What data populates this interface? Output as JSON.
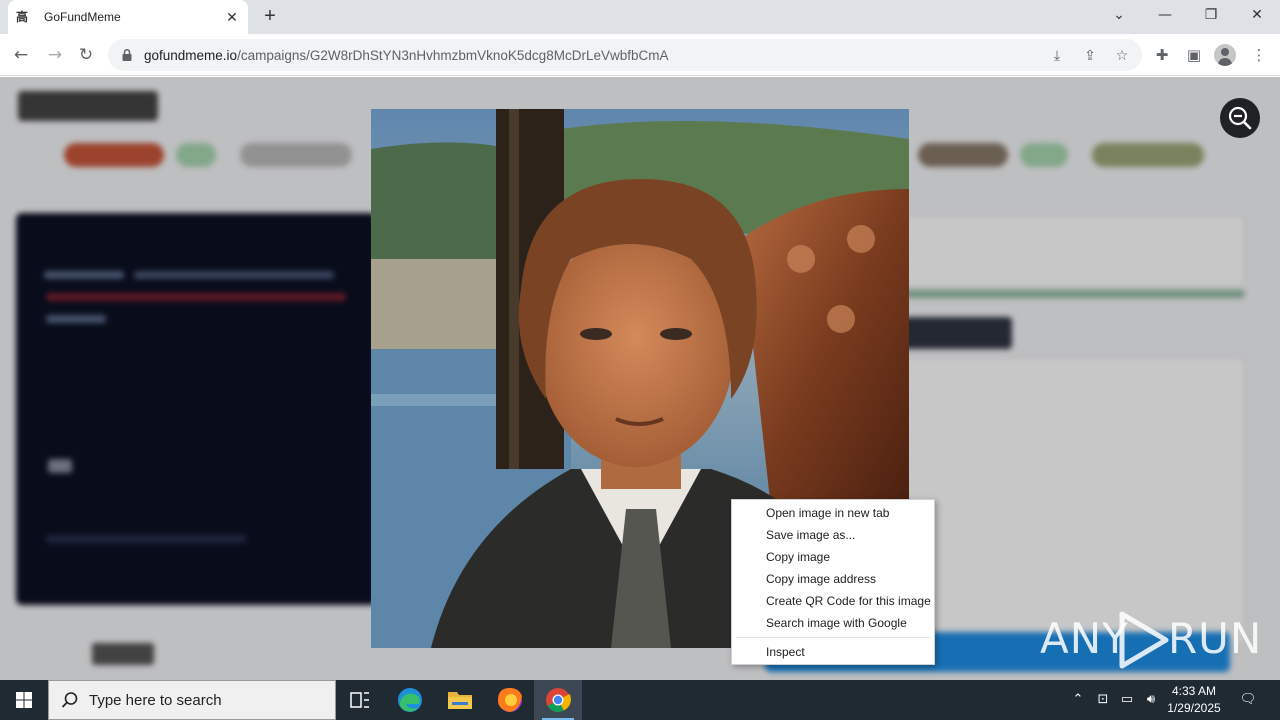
{
  "browser": {
    "tab_title": "GoFundMeme",
    "tab_favicon": "高",
    "url_host": "gofundmeme.io",
    "url_path": "/campaigns/G2W8rDhStYN3nHvhmzbmVknoK5dcg8McDrLeVwbfbCmA"
  },
  "context_menu": {
    "items": [
      "Open image in new tab",
      "Save image as...",
      "Copy image",
      "Copy image address",
      "Create QR Code for this image",
      "Search image with Google"
    ],
    "inspect": "Inspect"
  },
  "watermark": {
    "text_left": "ANY",
    "text_right": "RUN"
  },
  "taskbar": {
    "search_placeholder": "Type here to search",
    "time": "4:33 AM",
    "date": "1/29/2025"
  }
}
